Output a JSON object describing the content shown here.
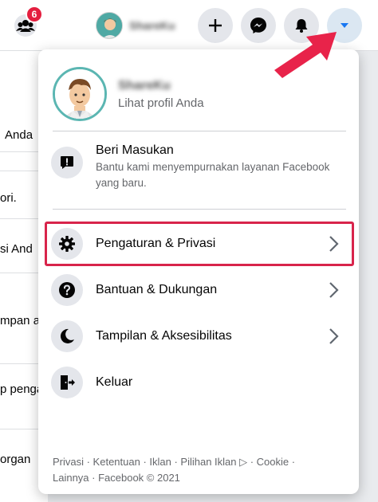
{
  "topbar": {
    "groups_badge": "6",
    "profile_name": "ShareKu",
    "create_label": "+",
    "accent_color": "#1877f2"
  },
  "background": {
    "fragments": [
      "Anda",
      "ori.",
      "si And",
      "mpan a",
      "p penga",
      "organ"
    ]
  },
  "menu": {
    "profile": {
      "name": "ShareKu",
      "subtitle": "Lihat profil Anda"
    },
    "feedback": {
      "title": "Beri Masukan",
      "description": "Bantu kami menyempurnakan layanan Facebook yang baru.",
      "icon": "exclamation-icon"
    },
    "items": [
      {
        "label": "Pengaturan & Privasi",
        "icon": "gear-icon",
        "has_chevron": true,
        "highlighted": true
      },
      {
        "label": "Bantuan & Dukungan",
        "icon": "question-icon",
        "has_chevron": true
      },
      {
        "label": "Tampilan & Aksesibilitas",
        "icon": "moon-icon",
        "has_chevron": true
      },
      {
        "label": "Keluar",
        "icon": "logout-icon",
        "has_chevron": false
      }
    ],
    "footer": {
      "line1": "Privasi · Ketentuan · Iklan · Pilihan Iklan ▷ · Cookie ·",
      "line2": "Lainnya · Facebook © 2021"
    }
  },
  "colors": {
    "highlight_border": "#d8244b",
    "arrow": "#e8234a",
    "icon_bg": "#e4e6eb",
    "avatar_ring": "#5bb6b2"
  }
}
